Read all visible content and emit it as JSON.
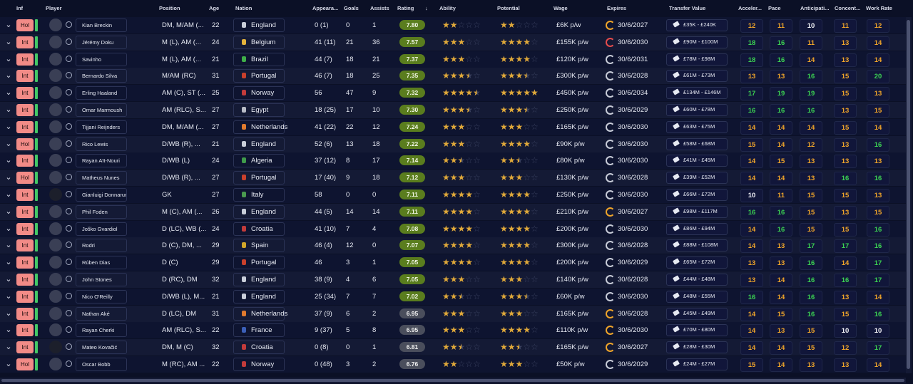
{
  "headers": {
    "inf": "Inf",
    "player": "Player",
    "position": "Position",
    "age": "Age",
    "nation": "Nation",
    "appearances": "Appeara...",
    "goals": "Goals",
    "assists": "Assists",
    "rating": "Rating",
    "ability": "Ability",
    "potential": "Potential",
    "wage": "Wage",
    "expires": "Expires",
    "transfer_value": "Transfer Value",
    "acceleration": "Acceler...",
    "pace": "Pace",
    "anticipation": "Anticipati...",
    "concentration": "Concent...",
    "work_rate": "Work Rate"
  },
  "sort_icon": "arrow-down-icon",
  "colors": {
    "attr_white": "#f3f4f8",
    "attr_orange": "#f0a52a",
    "attr_green": "#3bd152",
    "rating_green": "#5a7d1e",
    "rating_grey": "#4a4e5c",
    "inf_badge": "#f28b87",
    "star": "#e0a93a"
  },
  "players": [
    {
      "inf": "Hol",
      "name": "Kian Breckin",
      "position": "DM, M/AM (...",
      "age": "22",
      "nation": "England",
      "apps": "0 (1)",
      "goals": "0",
      "assists": "1",
      "rating": "7.80",
      "ability": 2,
      "potential": 2,
      "wage": "£6K p/w",
      "expires": "30/6/2027",
      "value": "£35K - £240K",
      "acc": "12",
      "pace": "11",
      "ant": "10",
      "con": "11",
      "wr": "12"
    },
    {
      "inf": "Int",
      "name": "Jérémy Doku",
      "position": "M (L), AM (...",
      "age": "24",
      "nation": "Belgium",
      "apps": "41 (11)",
      "goals": "21",
      "assists": "36",
      "rating": "7.57",
      "ability": 3,
      "potential": 4,
      "wage": "£155K p/w",
      "expires": "30/6/2030",
      "value": "£90M - £100M",
      "acc": "18",
      "pace": "16",
      "ant": "11",
      "con": "13",
      "wr": "14"
    },
    {
      "inf": "Int",
      "name": "Savinho",
      "position": "M (L), AM (...",
      "age": "21",
      "nation": "Brazil",
      "apps": "44 (7)",
      "goals": "18",
      "assists": "21",
      "rating": "7.37",
      "ability": 3,
      "potential": 4,
      "wage": "£120K p/w",
      "expires": "30/6/2031",
      "value": "£78M - £98M",
      "acc": "18",
      "pace": "16",
      "ant": "14",
      "con": "13",
      "wr": "14"
    },
    {
      "inf": "Int",
      "name": "Bernardo Silva",
      "position": "M/AM (RC)",
      "age": "31",
      "nation": "Portugal",
      "apps": "46 (7)",
      "goals": "18",
      "assists": "25",
      "rating": "7.35",
      "ability": 3.5,
      "potential": 3.5,
      "wage": "£300K p/w",
      "expires": "30/6/2028",
      "value": "£61M - £73M",
      "acc": "13",
      "pace": "13",
      "ant": "16",
      "con": "15",
      "wr": "20"
    },
    {
      "inf": "Int",
      "name": "Erling Haaland",
      "position": "AM (C), ST (...",
      "age": "25",
      "nation": "Norway",
      "apps": "56",
      "goals": "47",
      "assists": "9",
      "rating": "7.32",
      "ability": 4.5,
      "potential": 5,
      "wage": "£450K p/w",
      "expires": "30/6/2034",
      "value": "£134M - £146M",
      "acc": "17",
      "pace": "19",
      "ant": "19",
      "con": "15",
      "wr": "13"
    },
    {
      "inf": "Int",
      "name": "Omar Marmoush",
      "position": "AM (RLC), S...",
      "age": "27",
      "nation": "Egypt",
      "apps": "18 (25)",
      "goals": "17",
      "assists": "10",
      "rating": "7.30",
      "ability": 3.5,
      "potential": 3.5,
      "wage": "£250K p/w",
      "expires": "30/6/2029",
      "value": "£60M - £78M",
      "acc": "16",
      "pace": "16",
      "ant": "16",
      "con": "13",
      "wr": "15"
    },
    {
      "inf": "Int",
      "name": "Tijjani Reijnders",
      "position": "DM, M/AM (...",
      "age": "27",
      "nation": "Netherlands",
      "apps": "41 (22)",
      "goals": "22",
      "assists": "12",
      "rating": "7.24",
      "ability": 3,
      "potential": 3,
      "wage": "£165K p/w",
      "expires": "30/6/2030",
      "value": "£63M - £75M",
      "acc": "14",
      "pace": "14",
      "ant": "14",
      "con": "15",
      "wr": "14"
    },
    {
      "inf": "Hol",
      "name": "Rico Lewis",
      "position": "D/WB (R), ...",
      "age": "21",
      "nation": "England",
      "apps": "52 (6)",
      "goals": "13",
      "assists": "18",
      "rating": "7.22",
      "ability": 3,
      "potential": 4,
      "wage": "£90K p/w",
      "expires": "30/6/2030",
      "value": "£58M - £68M",
      "acc": "15",
      "pace": "14",
      "ant": "12",
      "con": "13",
      "wr": "16"
    },
    {
      "inf": "Int",
      "name": "Rayan Aït-Nouri",
      "position": "D/WB (L)",
      "age": "24",
      "nation": "Algeria",
      "apps": "37 (12)",
      "goals": "8",
      "assists": "17",
      "rating": "7.14",
      "ability": 2.5,
      "potential": 2.5,
      "wage": "£80K p/w",
      "expires": "30/6/2030",
      "value": "£41M - £45M",
      "acc": "14",
      "pace": "15",
      "ant": "13",
      "con": "13",
      "wr": "13"
    },
    {
      "inf": "Hol",
      "name": "Matheus Nunes",
      "position": "D/WB (R), ...",
      "age": "27",
      "nation": "Portugal",
      "apps": "17 (40)",
      "goals": "9",
      "assists": "18",
      "rating": "7.12",
      "ability": 3,
      "potential": 3,
      "wage": "£130K p/w",
      "expires": "30/6/2028",
      "value": "£39M - £52M",
      "acc": "14",
      "pace": "14",
      "ant": "13",
      "con": "16",
      "wr": "16"
    },
    {
      "inf": "Int",
      "name": "Gianluigi Donnarumma",
      "position": "GK",
      "age": "27",
      "nation": "Italy",
      "apps": "58",
      "goals": "0",
      "assists": "0",
      "rating": "7.11",
      "ability": 4,
      "potential": 4,
      "wage": "£250K p/w",
      "expires": "30/6/2030",
      "value": "£66M - £72M",
      "acc": "10",
      "pace": "11",
      "ant": "15",
      "con": "15",
      "wr": "13"
    },
    {
      "inf": "Int",
      "name": "Phil Foden",
      "position": "M (C), AM (...",
      "age": "26",
      "nation": "England",
      "apps": "44 (5)",
      "goals": "14",
      "assists": "14",
      "rating": "7.11",
      "ability": 4,
      "potential": 4,
      "wage": "£210K p/w",
      "expires": "30/6/2027",
      "value": "£98M - £117M",
      "acc": "16",
      "pace": "16",
      "ant": "15",
      "con": "13",
      "wr": "15"
    },
    {
      "inf": "Int",
      "name": "Joško Gvardiol",
      "position": "D (LC), WB (...",
      "age": "24",
      "nation": "Croatia",
      "apps": "41 (10)",
      "goals": "7",
      "assists": "4",
      "rating": "7.08",
      "ability": 4,
      "potential": 4,
      "wage": "£200K p/w",
      "expires": "30/6/2030",
      "value": "£86M - £94M",
      "acc": "14",
      "pace": "16",
      "ant": "15",
      "con": "15",
      "wr": "16"
    },
    {
      "inf": "Int",
      "name": "Rodri",
      "position": "D (C), DM, ...",
      "age": "29",
      "nation": "Spain",
      "apps": "46 (4)",
      "goals": "12",
      "assists": "0",
      "rating": "7.07",
      "ability": 4,
      "potential": 4,
      "wage": "£300K p/w",
      "expires": "30/6/2028",
      "value": "£88M - £108M",
      "acc": "14",
      "pace": "13",
      "ant": "17",
      "con": "17",
      "wr": "16"
    },
    {
      "inf": "Int",
      "name": "Rúben Dias",
      "position": "D (C)",
      "age": "29",
      "nation": "Portugal",
      "apps": "46",
      "goals": "3",
      "assists": "1",
      "rating": "7.05",
      "ability": 4,
      "potential": 4,
      "wage": "£200K p/w",
      "expires": "30/6/2029",
      "value": "£65M - £72M",
      "acc": "13",
      "pace": "13",
      "ant": "16",
      "con": "14",
      "wr": "17"
    },
    {
      "inf": "Int",
      "name": "John Stones",
      "position": "D (RC), DM",
      "age": "32",
      "nation": "England",
      "apps": "38 (9)",
      "goals": "4",
      "assists": "6",
      "rating": "7.05",
      "ability": 3,
      "potential": 3,
      "wage": "£140K p/w",
      "expires": "30/6/2028",
      "value": "£44M - £48M",
      "acc": "13",
      "pace": "14",
      "ant": "16",
      "con": "16",
      "wr": "17"
    },
    {
      "inf": "Int",
      "name": "Nico O'Reilly",
      "position": "D/WB (L), M...",
      "age": "21",
      "nation": "England",
      "apps": "25 (34)",
      "goals": "7",
      "assists": "7",
      "rating": "7.02",
      "ability": 2.5,
      "potential": 3.5,
      "wage": "£60K p/w",
      "expires": "30/6/2030",
      "value": "£48M - £55M",
      "acc": "16",
      "pace": "14",
      "ant": "16",
      "con": "13",
      "wr": "14"
    },
    {
      "inf": "Int",
      "name": "Nathan Aké",
      "position": "D (LC), DM",
      "age": "31",
      "nation": "Netherlands",
      "apps": "37 (9)",
      "goals": "6",
      "assists": "2",
      "rating": "6.95",
      "ability": 3,
      "potential": 3,
      "wage": "£165K p/w",
      "expires": "30/6/2028",
      "value": "£45M - £49M",
      "acc": "14",
      "pace": "15",
      "ant": "16",
      "con": "15",
      "wr": "16"
    },
    {
      "inf": "Int",
      "name": "Rayan Cherki",
      "position": "AM (RLC), S...",
      "age": "22",
      "nation": "France",
      "apps": "9 (37)",
      "goals": "5",
      "assists": "8",
      "rating": "6.95",
      "ability": 3,
      "potential": 4,
      "wage": "£110K p/w",
      "expires": "30/6/2030",
      "value": "£70M - £80M",
      "acc": "14",
      "pace": "13",
      "ant": "15",
      "con": "10",
      "wr": "10"
    },
    {
      "inf": "Int",
      "name": "Mateo Kovačić",
      "position": "DM, M (C)",
      "age": "32",
      "nation": "Croatia",
      "apps": "0 (8)",
      "goals": "0",
      "assists": "1",
      "rating": "6.81",
      "ability": 2.5,
      "potential": 2.5,
      "wage": "£165K p/w",
      "expires": "30/6/2027",
      "value": "£28M - £30M",
      "acc": "14",
      "pace": "14",
      "ant": "15",
      "con": "12",
      "wr": "17"
    },
    {
      "inf": "Hol",
      "name": "Oscar Bobb",
      "position": "M (RC), AM ...",
      "age": "22",
      "nation": "Norway",
      "apps": "0 (48)",
      "goals": "3",
      "assists": "2",
      "rating": "6.76",
      "ability": 2,
      "potential": 3,
      "wage": "£50K p/w",
      "expires": "30/6/2029",
      "value": "£24M - £27M",
      "acc": "15",
      "pace": "14",
      "ant": "13",
      "con": "13",
      "wr": "14"
    }
  ]
}
